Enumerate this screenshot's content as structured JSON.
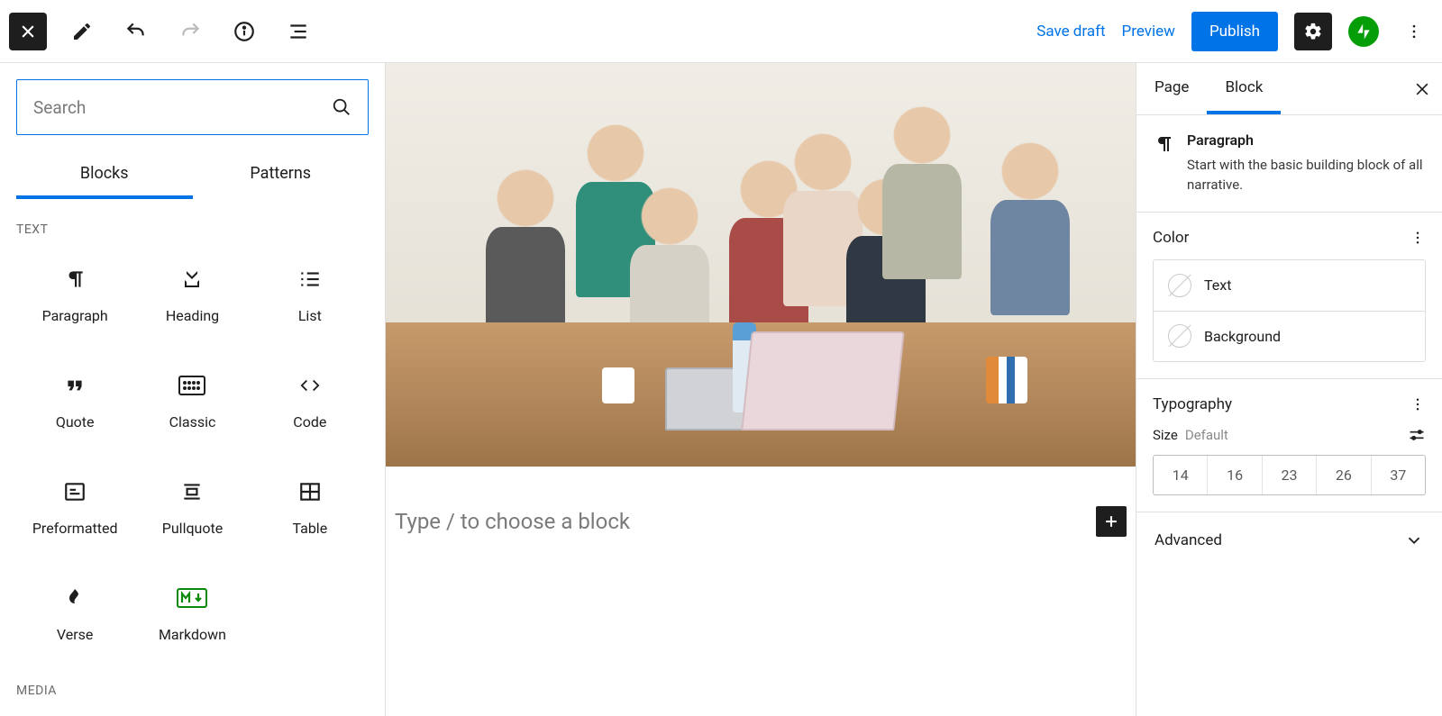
{
  "topbar": {
    "save_draft": "Save draft",
    "preview": "Preview",
    "publish": "Publish"
  },
  "inserter": {
    "search_placeholder": "Search",
    "tab_blocks": "Blocks",
    "tab_patterns": "Patterns",
    "section_text": "Text",
    "section_media": "Media",
    "blocks": [
      {
        "label": "Paragraph",
        "icon": "paragraph"
      },
      {
        "label": "Heading",
        "icon": "heading"
      },
      {
        "label": "List",
        "icon": "list"
      },
      {
        "label": "Quote",
        "icon": "quote"
      },
      {
        "label": "Classic",
        "icon": "classic"
      },
      {
        "label": "Code",
        "icon": "code"
      },
      {
        "label": "Preformatted",
        "icon": "preformatted"
      },
      {
        "label": "Pullquote",
        "icon": "pullquote"
      },
      {
        "label": "Table",
        "icon": "table"
      },
      {
        "label": "Verse",
        "icon": "verse"
      },
      {
        "label": "Markdown",
        "icon": "markdown"
      }
    ]
  },
  "editor": {
    "placeholder": "Type / to choose a block"
  },
  "settings": {
    "tab_page": "Page",
    "tab_block": "Block",
    "block_title": "Paragraph",
    "block_desc": "Start with the basic building block of all narrative.",
    "color_heading": "Color",
    "color_text": "Text",
    "color_bg": "Background",
    "typo_heading": "Typography",
    "size_label": "Size",
    "size_default": "Default",
    "sizes": [
      "14",
      "16",
      "23",
      "26",
      "37"
    ],
    "advanced": "Advanced"
  }
}
